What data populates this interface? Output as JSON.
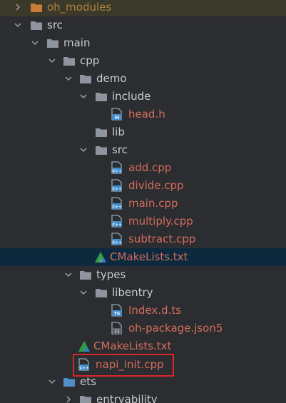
{
  "tree": {
    "items": [
      {
        "label": "oh_modules"
      },
      {
        "label": "src"
      },
      {
        "label": "main"
      },
      {
        "label": "cpp"
      },
      {
        "label": "demo"
      },
      {
        "label": "include"
      },
      {
        "label": "head.h"
      },
      {
        "label": "lib"
      },
      {
        "label": "src"
      },
      {
        "label": "add.cpp"
      },
      {
        "label": "divide.cpp"
      },
      {
        "label": "main.cpp"
      },
      {
        "label": "multiply.cpp"
      },
      {
        "label": "subtract.cpp"
      },
      {
        "label": "CMakeLists.txt"
      },
      {
        "label": "types"
      },
      {
        "label": "libentry"
      },
      {
        "label": "Index.d.ts"
      },
      {
        "label": "oh-package.json5"
      },
      {
        "label": "CMakeLists.txt"
      },
      {
        "label": "napi_init.cpp"
      },
      {
        "label": "ets"
      },
      {
        "label": "entryability"
      }
    ],
    "icon_badges": {
      "header": "H",
      "cpp": "C++",
      "ts": "TS",
      "json": "{}"
    }
  },
  "colors": {
    "background": "#2b2d30",
    "selected_row": "#0d293e",
    "modified_text": "#d46c5c",
    "excluded_text": "#b0823f",
    "folder_gray": "#8f959e",
    "folder_blue": "#4f8ec9",
    "folder_orange": "#c97b3a",
    "highlight_box": "#d9262b"
  }
}
